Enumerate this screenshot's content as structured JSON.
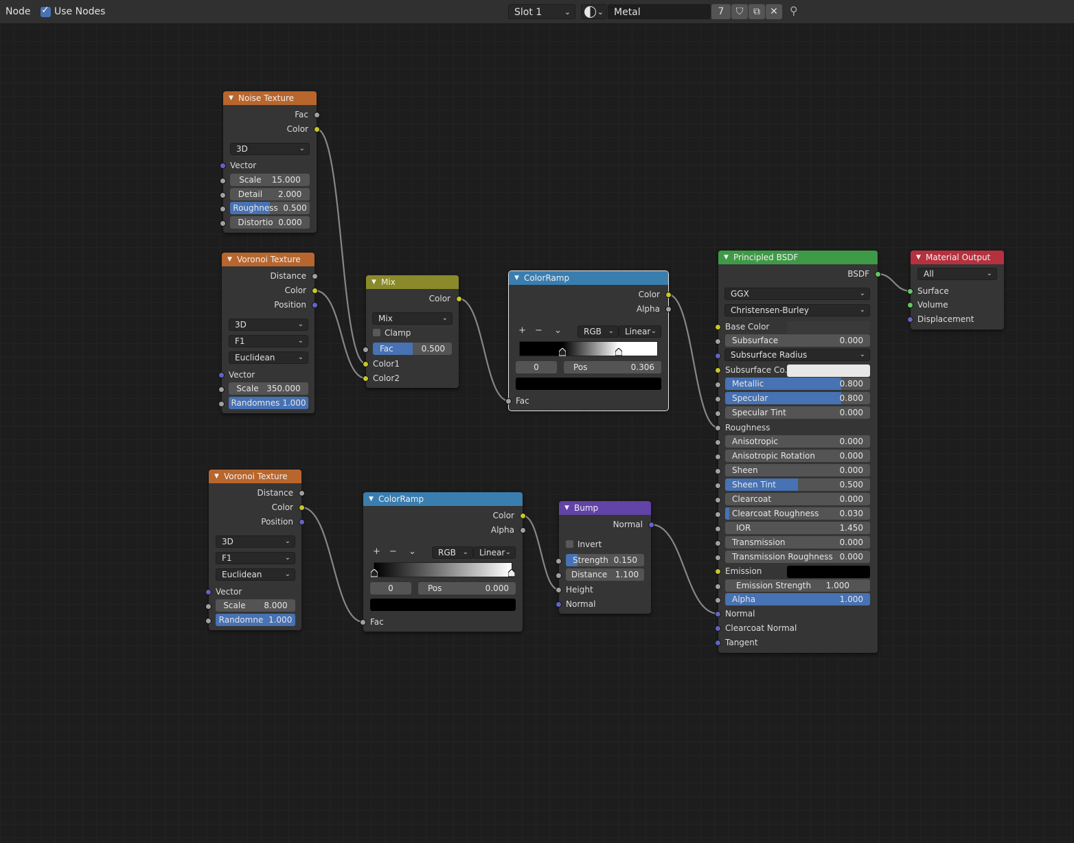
{
  "header": {
    "menu_node": "Node",
    "use_nodes_label": "Use Nodes",
    "slot": "Slot 1",
    "material_name": "Metal",
    "user_count": "7"
  },
  "nodes": {
    "noise": {
      "title": "Noise Texture",
      "out_fac": "Fac",
      "out_color": "Color",
      "dim": "3D",
      "in_vector": "Vector",
      "scale_label": "Scale",
      "scale_value": "15.000",
      "detail_label": "Detail",
      "detail_value": "2.000",
      "rough_label": "Roughness",
      "rough_value": "0.500",
      "dist_label": "Distortio",
      "dist_value": "0.000"
    },
    "voronoi1": {
      "title": "Voronoi Texture",
      "out_distance": "Distance",
      "out_color": "Color",
      "out_position": "Position",
      "dim": "3D",
      "feature": "F1",
      "metric": "Euclidean",
      "in_vector": "Vector",
      "scale_label": "Scale",
      "scale_value": "350.000",
      "rand_label": "Randomnes",
      "rand_value": "1.000"
    },
    "voronoi2": {
      "title": "Voronoi Texture",
      "out_distance": "Distance",
      "out_color": "Color",
      "out_position": "Position",
      "dim": "3D",
      "feature": "F1",
      "metric": "Euclidean",
      "in_vector": "Vector",
      "scale_label": "Scale",
      "scale_value": "8.000",
      "rand_label": "Randomne",
      "rand_value": "1.000"
    },
    "mix": {
      "title": "Mix",
      "out_color": "Color",
      "blend": "Mix",
      "clamp_label": "Clamp",
      "fac_label": "Fac",
      "fac_value": "0.500",
      "in_color1": "Color1",
      "in_color2": "Color2"
    },
    "ramp1": {
      "title": "ColorRamp",
      "out_color": "Color",
      "out_alpha": "Alpha",
      "color_mode": "RGB",
      "interpolation": "Linear",
      "stop_index": "0",
      "pos_label": "Pos",
      "pos_value": "0.306",
      "in_fac": "Fac",
      "stops": [
        0.31,
        0.72
      ]
    },
    "ramp2": {
      "title": "ColorRamp",
      "out_color": "Color",
      "out_alpha": "Alpha",
      "color_mode": "RGB",
      "interpolation": "Linear",
      "stop_index": "0",
      "pos_label": "Pos",
      "pos_value": "0.000",
      "in_fac": "Fac",
      "stops": [
        0.0,
        1.0
      ]
    },
    "bump": {
      "title": "Bump",
      "out_normal": "Normal",
      "invert_label": "Invert",
      "strength_label": "Strength",
      "strength_value": "0.150",
      "distance_label": "Distance",
      "distance_value": "1.100",
      "in_height": "Height",
      "in_normal": "Normal"
    },
    "bsdf": {
      "title": "Principled BSDF",
      "out_bsdf": "BSDF",
      "distribution": "GGX",
      "subsurface_method": "Christensen-Burley",
      "base_color": "Base Color",
      "subsurface": "Subsurface",
      "subsurface_v": "0.000",
      "subsurface_radius": "Subsurface Radius",
      "subsurface_color": "Subsurface Co...",
      "metallic": "Metallic",
      "metallic_v": "0.800",
      "specular": "Specular",
      "specular_v": "0.800",
      "specular_tint": "Specular Tint",
      "specular_tint_v": "0.000",
      "roughness": "Roughness",
      "anisotropic": "Anisotropic",
      "anisotropic_v": "0.000",
      "aniso_rot": "Anisotropic Rotation",
      "aniso_rot_v": "0.000",
      "sheen": "Sheen",
      "sheen_v": "0.000",
      "sheen_tint": "Sheen Tint",
      "sheen_tint_v": "0.500",
      "clearcoat": "Clearcoat",
      "clearcoat_v": "0.000",
      "clearcoat_rough": "Clearcoat Roughness",
      "clearcoat_rough_v": "0.030",
      "ior": "IOR",
      "ior_v": "1.450",
      "transmission": "Transmission",
      "transmission_v": "0.000",
      "trans_rough": "Transmission Roughness",
      "trans_rough_v": "0.000",
      "emission": "Emission",
      "emission_strength": "Emission Strength",
      "emission_strength_v": "1.000",
      "alpha": "Alpha",
      "alpha_v": "1.000",
      "normal": "Normal",
      "clearcoat_normal": "Clearcoat Normal",
      "tangent": "Tangent"
    },
    "output": {
      "title": "Material Output",
      "target": "All",
      "surface": "Surface",
      "volume": "Volume",
      "displacement": "Displacement"
    }
  },
  "colors": {
    "texture_header": "#b8662d",
    "converter_header": "#3a7eb0",
    "shader_header": "#3e9a46",
    "output_header": "#b6313e",
    "vector_header": "#6243a8",
    "color_header": "#8a8a2a",
    "accent": "#4772b3"
  }
}
